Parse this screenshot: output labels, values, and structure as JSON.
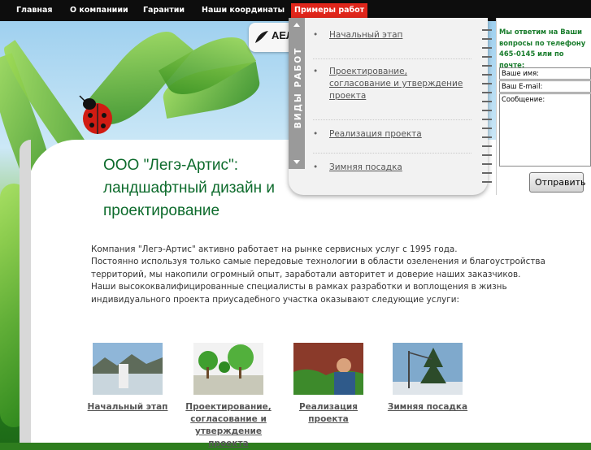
{
  "nav": {
    "items": [
      {
        "label": "Главная",
        "active": false
      },
      {
        "label": "О компаниии",
        "active": false
      },
      {
        "label": "Гарантии",
        "active": false
      },
      {
        "label": "Наши координаты",
        "active": false
      },
      {
        "label": "Примеры работ",
        "active": true
      }
    ]
  },
  "logo": {
    "text": "АЕЛ",
    "icon": "logo-leaf-icon"
  },
  "services_menu": {
    "tab_label": "ВИДЫ РАБОТ",
    "items": [
      "Начальный этап",
      "Проектирование, согласование и утверждение проекта",
      "Реализация проекта",
      "Зимняя посадка"
    ]
  },
  "contact_form": {
    "intro": "Мы ответим на Ваши вопросы по телефону 465-0145 или по почте:",
    "name_label": "Ваше имя:",
    "email_label": "Ваш E-mail:",
    "message_label": "Сообщение:",
    "submit_label": "Отправить"
  },
  "page": {
    "title": "ООО \"Легэ-Артис\": ландшафтный дизайн и проектирование",
    "intro_line1": "Компания \"Легэ-Артис\" активно работает на рынке сервисных услуг с 1995 года.",
    "intro_line2": "Постоянно используя только самые передовые технологии в области озеленения и благоустройства территорий, мы накопили огромный опыт, заработали авторитет и доверие наших заказчиков. Наши высококвалифицированные специалисты в рамках разработки и воплощения в жизнь индивидуального проекта приусадебного участка оказывают следующие услуги:"
  },
  "services": [
    {
      "label": "Начальный этап",
      "image": "landscape-photo"
    },
    {
      "label": "Проектирование, согласование и утверждение проекта",
      "image": "garden-plan-photo"
    },
    {
      "label": "Реализация проекта",
      "image": "worker-photo"
    },
    {
      "label": "Зимняя посадка",
      "image": "tree-planting-photo"
    }
  ],
  "colors": {
    "nav_bg": "#0d0d0d",
    "nav_active": "#e0261b",
    "title_green": "#0d6b2c",
    "contact_green": "#1a7d2d"
  }
}
